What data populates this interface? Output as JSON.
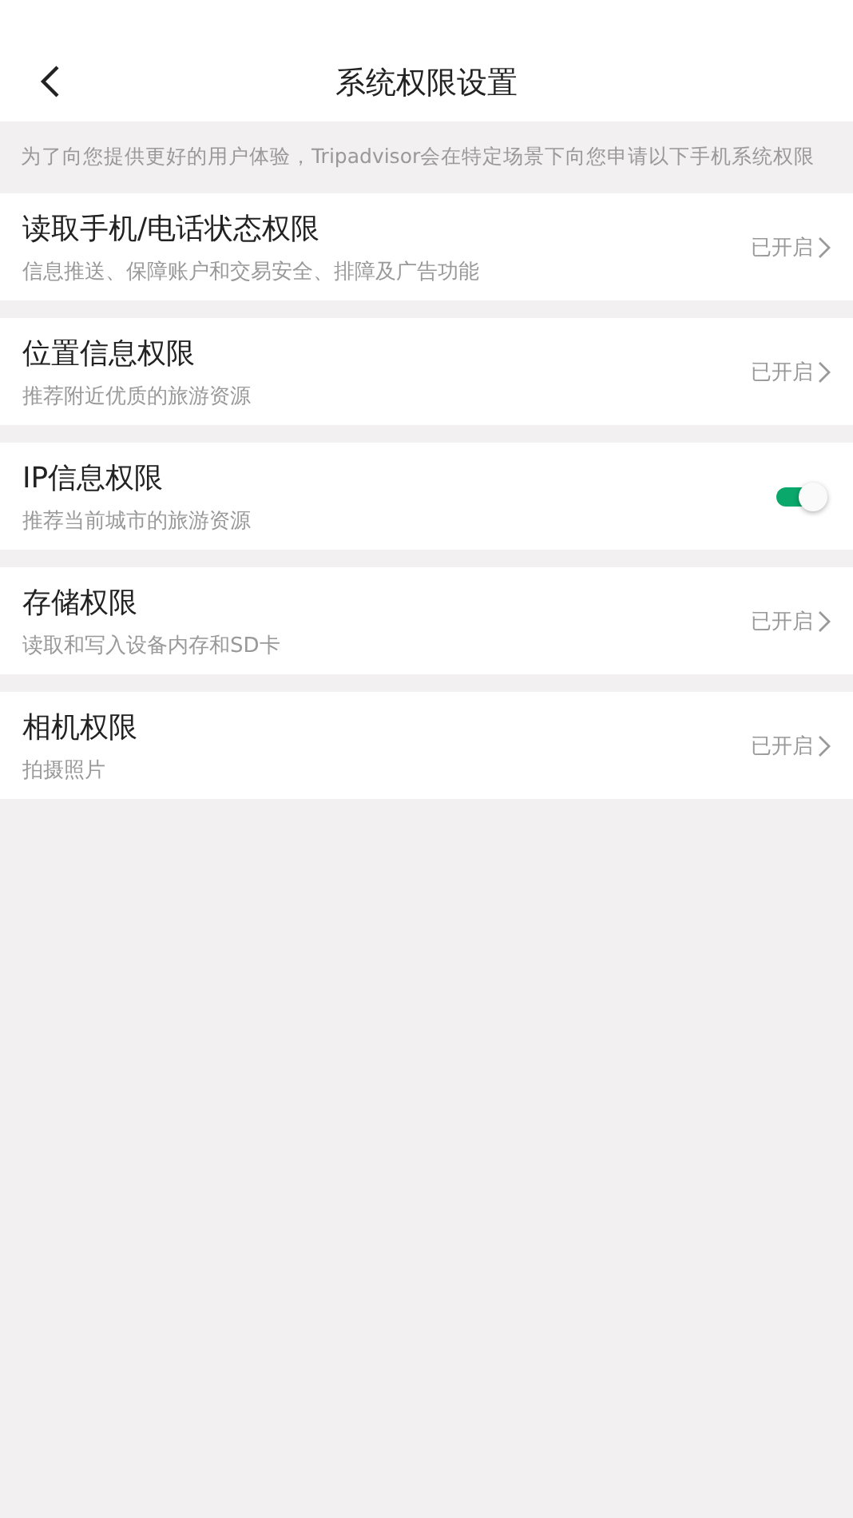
{
  "header": {
    "title": "系统权限设置"
  },
  "notice": "为了向您提供更好的用户体验，Tripadvisor会在特定场景下向您申请以下手机系统权限",
  "permissions": [
    {
      "kind": "link",
      "title": "读取手机/电话状态权限",
      "description": "信息推送、保障账户和交易安全、排障及广告功能",
      "status": "已开启"
    },
    {
      "kind": "link",
      "title": "位置信息权限",
      "description": "推荐附近优质的旅游资源",
      "status": "已开启"
    },
    {
      "kind": "switch",
      "title": "IP信息权限",
      "description": "推荐当前城市的旅游资源",
      "on": true
    },
    {
      "kind": "link",
      "title": "存储权限",
      "description": "读取和写入设备内存和SD卡",
      "status": "已开启"
    },
    {
      "kind": "link",
      "title": "相机权限",
      "description": "拍摄照片",
      "status": "已开启"
    }
  ]
}
